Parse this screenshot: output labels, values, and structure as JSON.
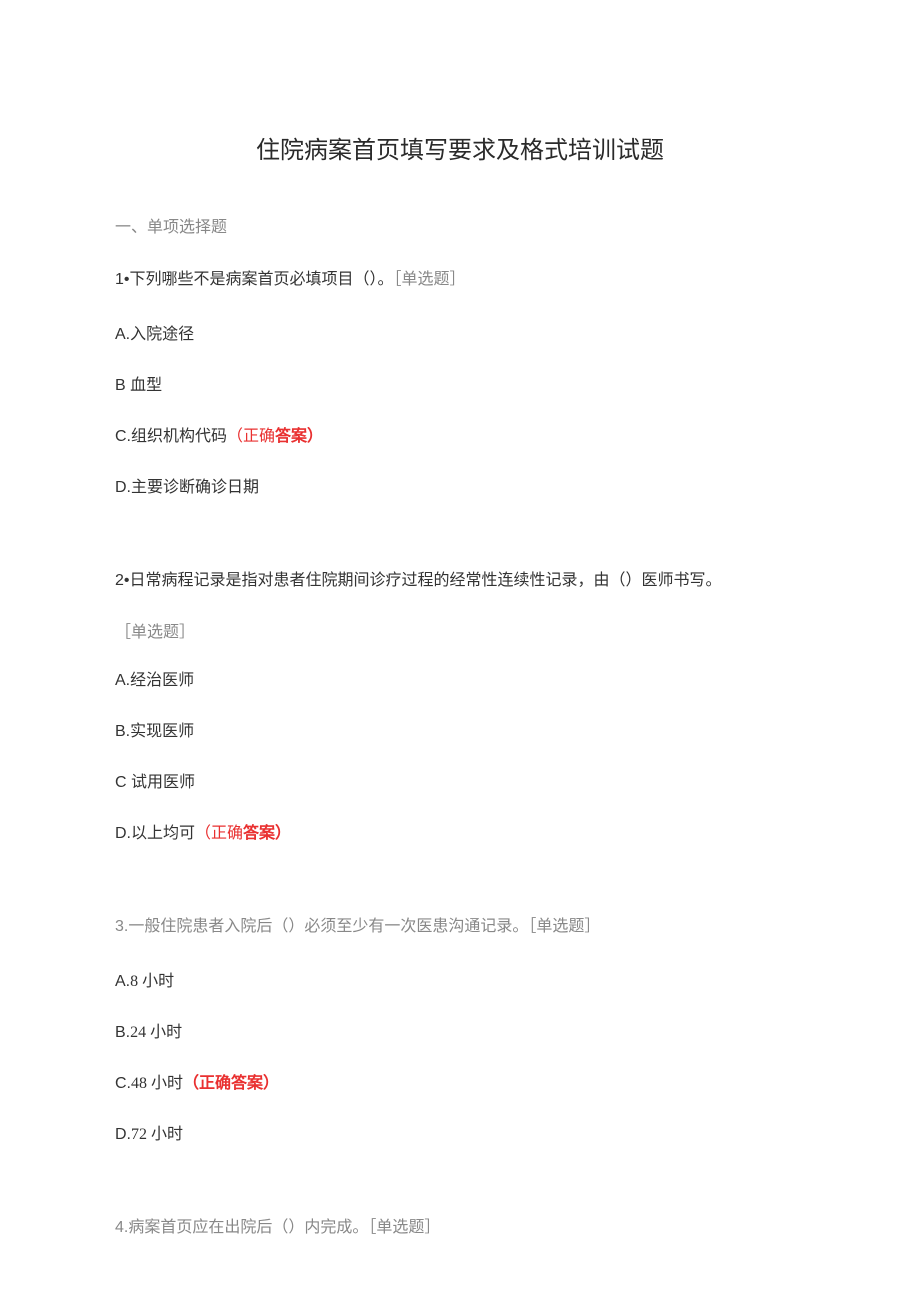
{
  "title": "住院病案首页填写要求及格式培训试题",
  "section_header": "一、单项选择题",
  "q1": {
    "num": "1•",
    "stem_main": "下列哪些不是病案首页必填项目（）。",
    "tag": "［单选题］",
    "optA_letter": "A.",
    "optA_text": "入院途径",
    "optB_letter": "B ",
    "optB_text": "血型",
    "optC_letter": "C.",
    "optC_text": "组织机构代码",
    "optC_ans_open": "（正确",
    "optC_ans_bold": "答案）",
    "optD_letter": "D.",
    "optD_text": "主要诊断确诊日期"
  },
  "q2": {
    "num": "2•",
    "stem_main": "日常病程记录是指对患者住院期间诊疗过程的经常性连续性记录，由（）医师书写。",
    "tag": "［单选题］",
    "optA_letter": "A.",
    "optA_text": "经治医师",
    "optB_letter": "B.",
    "optB_text": "实现医师",
    "optC_letter": "C ",
    "optC_text": "试用医师",
    "optD_letter": "D.",
    "optD_text": "以上均可",
    "optD_ans_open": "（正确",
    "optD_ans_bold": "答案）"
  },
  "q3": {
    "num": "3.",
    "stem_pre": "一般住院患者入院后（）必须至少有一次医患沟通记录。",
    "tag": "［单选题］",
    "optA_letter": "A.",
    "optA_text": "8 小时",
    "optB_letter": "B.",
    "optB_text": "24 小时",
    "optC_letter": "C.",
    "optC_text": "48 小时",
    "optC_ans": "（正确答案）",
    "optD_letter": "D.",
    "optD_text": "72 小时"
  },
  "q4": {
    "num": "4.",
    "stem_main": "病案首页应在出院后（）内完成。",
    "tag": "［单选题］"
  }
}
